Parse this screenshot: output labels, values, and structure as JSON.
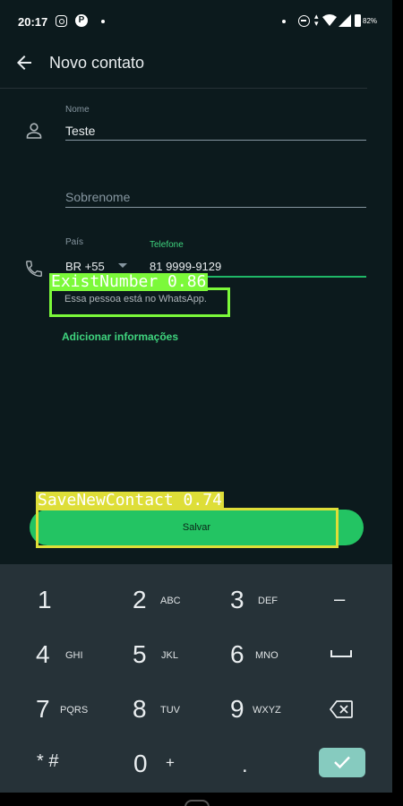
{
  "status_bar": {
    "time": "20:17",
    "pinterest_glyph": "P",
    "battery_percent": "82%",
    "icons": [
      "instagram-icon",
      "pinterest-icon",
      "dnd-icon",
      "data-arrows-icon",
      "wifi-icon",
      "signal-icon",
      "battery-icon"
    ]
  },
  "app_bar": {
    "title": "Novo contato",
    "back_icon": "arrow-left-icon"
  },
  "form": {
    "first_name": {
      "label": "Nome",
      "value": "Teste"
    },
    "last_name": {
      "placeholder": "Sobrenome"
    },
    "country": {
      "label": "País",
      "value": "BR +55"
    },
    "phone": {
      "label": "Telefone",
      "value": "81 9999-9129"
    },
    "whatsapp_note": "Essa pessoa está no WhatsApp.",
    "add_info_label": "Adicionar informações"
  },
  "detections": [
    {
      "label": "ExistNumber 0.86",
      "color": "#7cf93a"
    },
    {
      "label": "SaveNewContact 0.74",
      "color": "#dede38"
    }
  ],
  "save_button": {
    "label": "Salvar"
  },
  "keypad": {
    "keys": [
      {
        "digit": "1",
        "letters": ""
      },
      {
        "digit": "2",
        "letters": "ABC"
      },
      {
        "digit": "3",
        "letters": "DEF"
      },
      {
        "digit": "4",
        "letters": "GHI"
      },
      {
        "digit": "5",
        "letters": "JKL"
      },
      {
        "digit": "6",
        "letters": "MNO"
      },
      {
        "digit": "7",
        "letters": "PQRS"
      },
      {
        "digit": "8",
        "letters": "TUV"
      },
      {
        "digit": "9",
        "letters": "WXYZ"
      },
      {
        "digit": "0",
        "letters": "+"
      }
    ],
    "minus_key": "–",
    "star_hash_key": "* #",
    "dot_key": ".",
    "icons": [
      "space-icon",
      "backspace-icon",
      "checkmark-icon"
    ]
  },
  "colors": {
    "accent": "#23c463",
    "background": "#0c1a1d",
    "keypad_background": "#263238"
  }
}
